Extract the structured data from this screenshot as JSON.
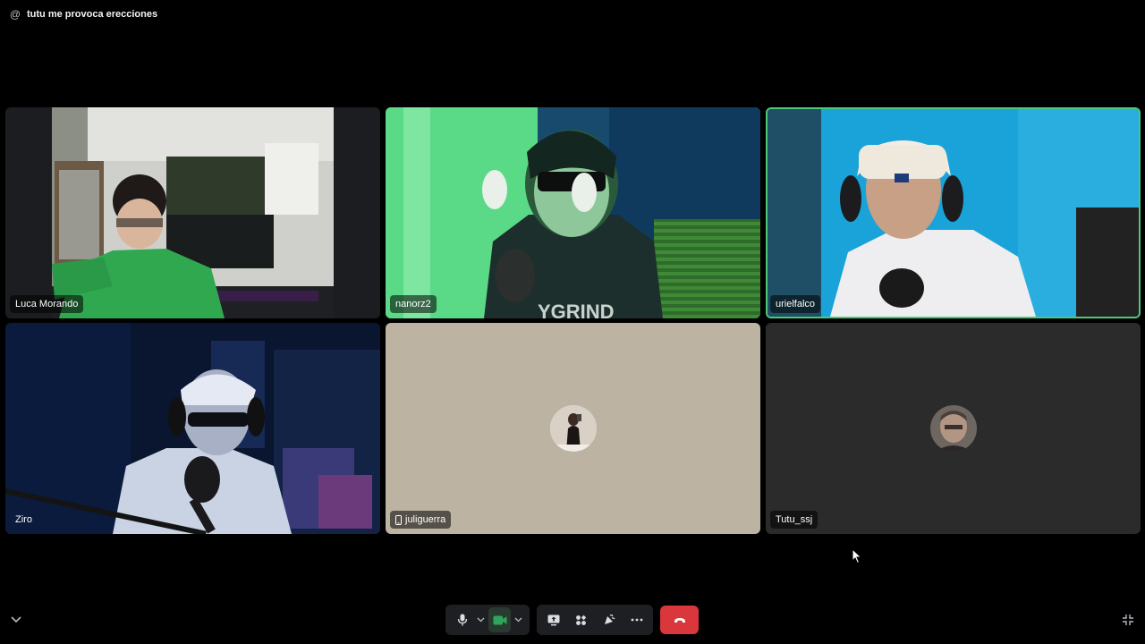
{
  "channel": {
    "icon": "at-sign-icon",
    "title": "tutu me provoca erecciones"
  },
  "participants": [
    {
      "name": "Luca Morando",
      "video": true,
      "speaking": false
    },
    {
      "name": "nanorz2",
      "video": true,
      "speaking": false
    },
    {
      "name": "urielfalco",
      "video": true,
      "speaking": true
    },
    {
      "name": "Ziro",
      "video": true,
      "speaking": false
    },
    {
      "name": "juliguerra",
      "video": false,
      "mobile": true,
      "tile_color": "#bdb3a2"
    },
    {
      "name": "Tutu_ssj",
      "video": false,
      "tile_color": "#2b2b2b"
    }
  ],
  "controls": {
    "group1": [
      "microphone-icon",
      "chevron-down-icon",
      "camera-icon",
      "chevron-down-icon"
    ],
    "group2": [
      "screen-share-icon",
      "activities-icon",
      "soundboard-icon",
      "more-icon"
    ],
    "hangup": "phone-hangup-icon",
    "left": "chevron-down-icon",
    "right": "collapse-icon"
  },
  "colors": {
    "background": "#000000",
    "toolbar": "#1e1f22",
    "speaking_ring": "#4ec97a",
    "camera_active": "#2fa55c",
    "hangup": "#da373c"
  }
}
